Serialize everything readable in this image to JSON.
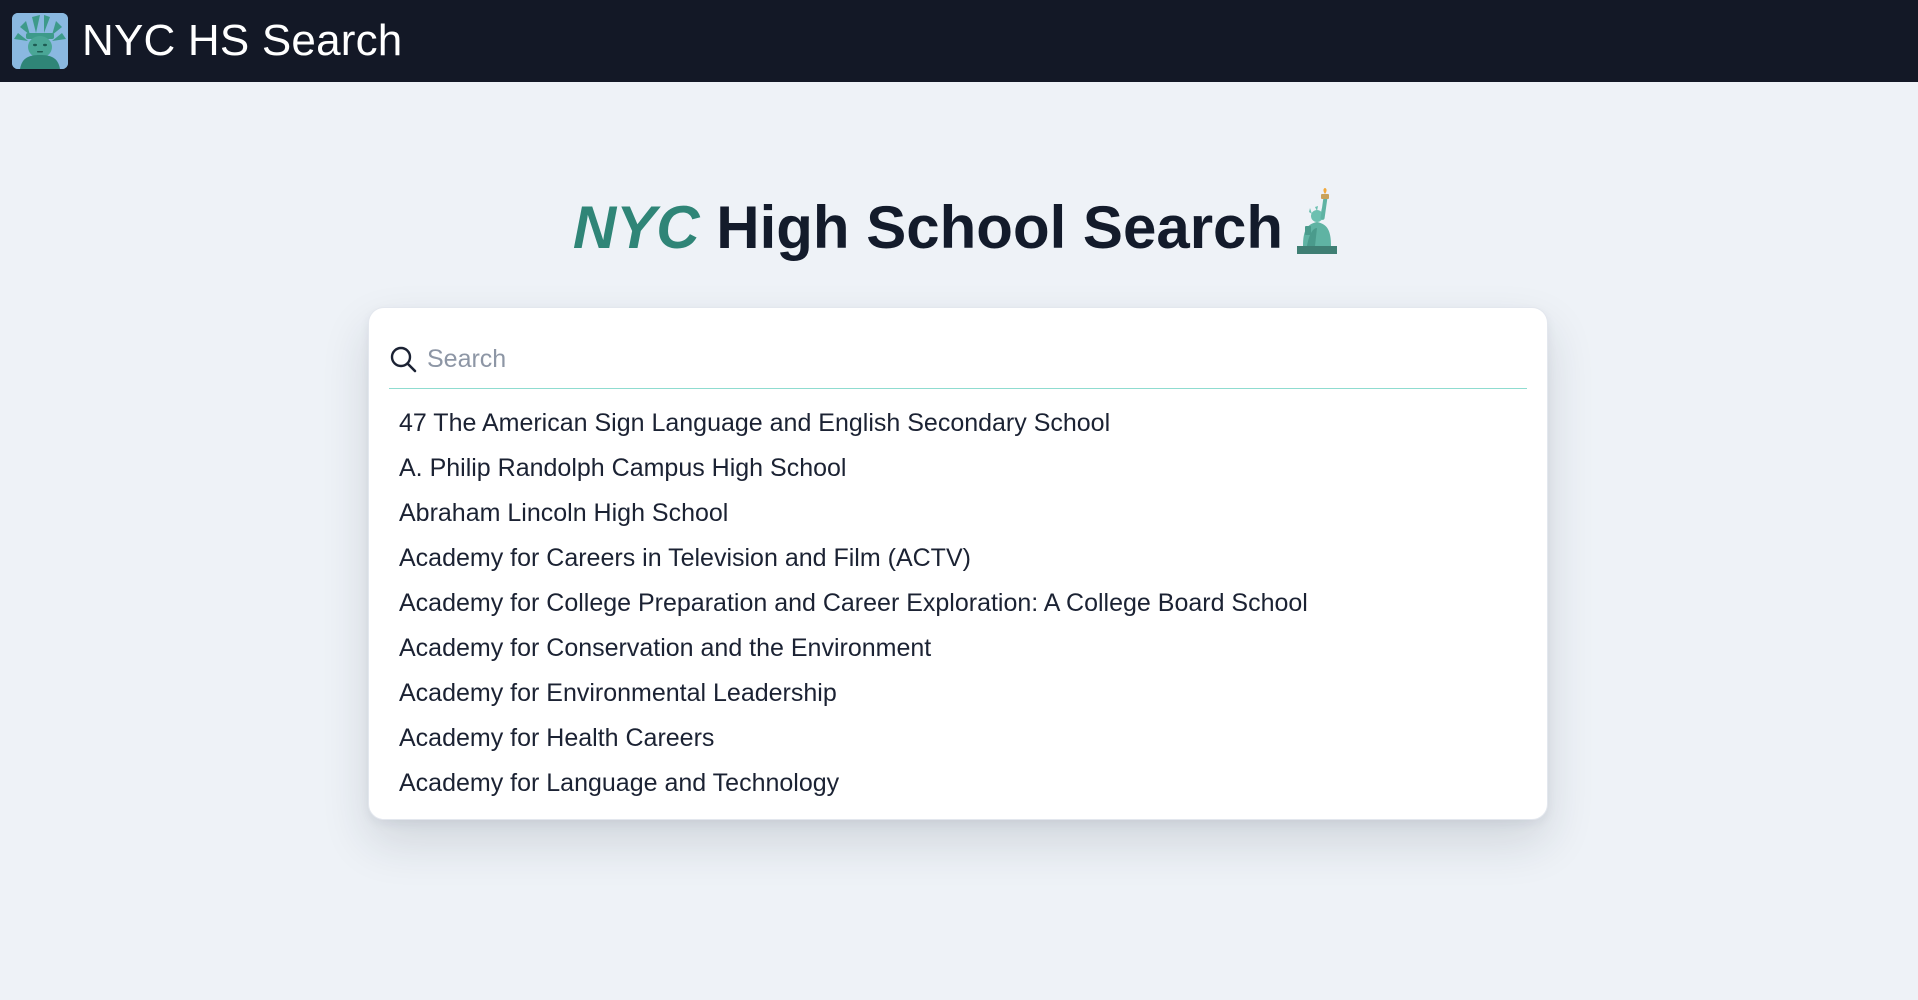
{
  "header": {
    "app_name": "NYC HS Search",
    "logo_icon": "statue-of-liberty-icon"
  },
  "hero": {
    "title_accent": "NYC",
    "title_rest": " High School Search",
    "title_emoji": "statue-of-liberty-icon"
  },
  "search": {
    "placeholder": "Search",
    "value": "",
    "icon": "search-icon"
  },
  "results": [
    "47 The American Sign Language and English Secondary School",
    "A. Philip Randolph Campus High School",
    "Abraham Lincoln High School",
    "Academy for Careers in Television and Film (ACTV)",
    "Academy for College Preparation and Career Exploration: A College Board School",
    "Academy for Conservation and the Environment",
    "Academy for Environmental Leadership",
    "Academy for Health Careers",
    "Academy for Language and Technology"
  ],
  "colors": {
    "topbar": "#131826",
    "accent": "#2f8577",
    "page_background": "#eef2f7",
    "search_underline": "#8fdcd0"
  }
}
